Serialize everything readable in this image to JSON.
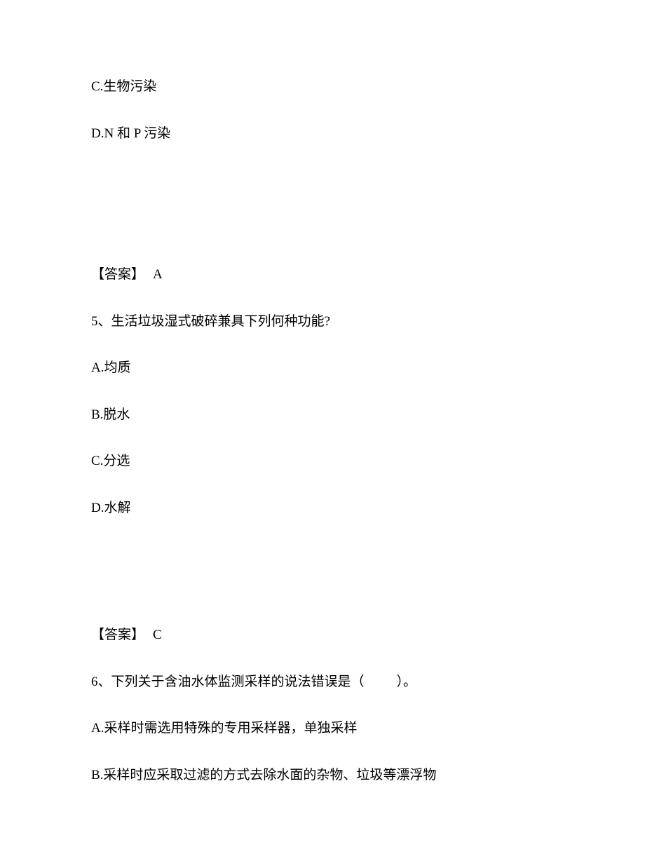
{
  "options_leading": [
    "C.生物污染",
    "D.N 和 P 污染"
  ],
  "answer_block_1": {
    "label": "【答案】",
    "letter": "A"
  },
  "question_5": {
    "number": "5、",
    "text": "生活垃圾湿式破碎兼具下列何种功能?",
    "options": [
      "A.均质",
      "B.脱水",
      "C.分选",
      "D.水解"
    ]
  },
  "answer_block_2": {
    "label": "【答案】",
    "letter": "C"
  },
  "question_6": {
    "number": "6、",
    "prefix": "下列关于含油水体监测采样的说法错误是（",
    "suffix": "）。",
    "options": [
      "A.采样时需选用特殊的专用采样器，单独采样",
      "B.采样时应采取过滤的方式去除水面的杂物、垃圾等漂浮物"
    ]
  }
}
